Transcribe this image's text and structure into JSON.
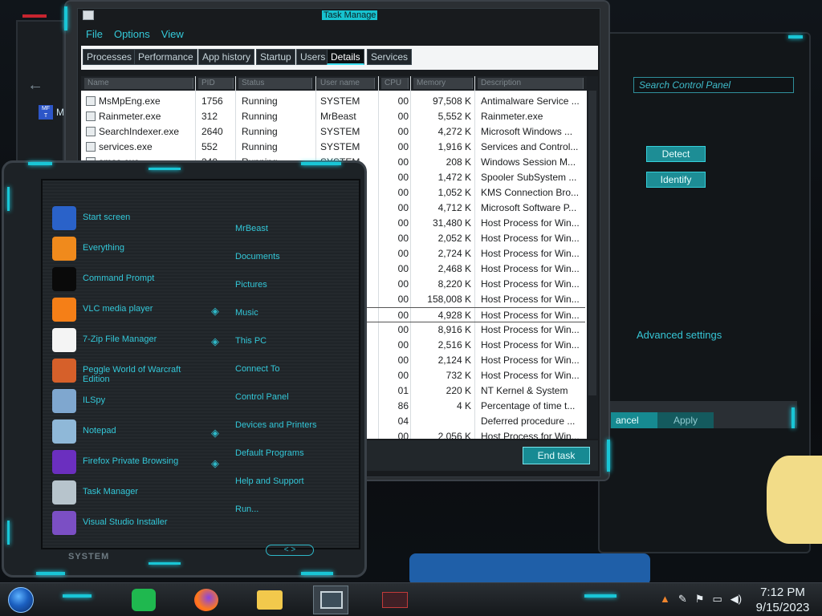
{
  "bg_window": {
    "label": "ME"
  },
  "control_panel": {
    "search_placeholder": "Search Control Panel",
    "detect_label": "Detect",
    "identify_label": "Identify",
    "advanced_label": "Advanced settings",
    "cancel_label": "ancel",
    "apply_label": "Apply"
  },
  "task_manager": {
    "title": "Task Manage",
    "menu": [
      "File",
      "Options",
      "View"
    ],
    "tabs": [
      "Processes",
      "Performance",
      "App history",
      "Startup",
      "Users",
      "Details",
      "Services"
    ],
    "columns": [
      "Name",
      "PID",
      "Status",
      "User name",
      "CPU",
      "Memory",
      "Description"
    ],
    "rows": [
      {
        "name": "MsMpEng.exe",
        "pid": "1756",
        "status": "Running",
        "user": "SYSTEM",
        "cpu": "00",
        "mem": "97,508 K",
        "desc": "Antimalware Service ..."
      },
      {
        "name": "Rainmeter.exe",
        "pid": "312",
        "status": "Running",
        "user": "MrBeast",
        "cpu": "00",
        "mem": "5,552 K",
        "desc": "Rainmeter.exe"
      },
      {
        "name": "SearchIndexer.exe",
        "pid": "2640",
        "status": "Running",
        "user": "SYSTEM",
        "cpu": "00",
        "mem": "4,272 K",
        "desc": "Microsoft Windows ..."
      },
      {
        "name": "services.exe",
        "pid": "552",
        "status": "Running",
        "user": "SYSTEM",
        "cpu": "00",
        "mem": "1,916 K",
        "desc": "Services and Control..."
      },
      {
        "name": "smss.exe",
        "pid": "340",
        "status": "Running",
        "user": "SYSTEM",
        "cpu": "00",
        "mem": "208 K",
        "desc": "Windows Session M..."
      },
      {
        "name": "",
        "pid": "",
        "status": "",
        "user": "",
        "cpu": "00",
        "mem": "1,472 K",
        "desc": "Spooler SubSystem ..."
      },
      {
        "name": "",
        "pid": "",
        "status": "",
        "user": "",
        "cpu": "00",
        "mem": "1,052 K",
        "desc": "KMS Connection Bro..."
      },
      {
        "name": "",
        "pid": "",
        "status": "",
        "user": "",
        "cpu": "00",
        "mem": "4,712 K",
        "desc": "Microsoft Software P..."
      },
      {
        "name": "",
        "pid": "",
        "status": "",
        "user": "",
        "cpu": "00",
        "mem": "31,480 K",
        "desc": "Host Process for Win..."
      },
      {
        "name": "",
        "pid": "",
        "status": "",
        "user": "",
        "cpu": "00",
        "mem": "2,052 K",
        "desc": "Host Process for Win..."
      },
      {
        "name": "",
        "pid": "",
        "status": "",
        "user": "",
        "cpu": "00",
        "mem": "2,724 K",
        "desc": "Host Process for Win..."
      },
      {
        "name": "",
        "pid": "",
        "status": "",
        "user": "",
        "cpu": "00",
        "mem": "2,468 K",
        "desc": "Host Process for Win..."
      },
      {
        "name": "",
        "pid": "",
        "status": "",
        "user": "",
        "cpu": "00",
        "mem": "8,220 K",
        "desc": "Host Process for Win..."
      },
      {
        "name": "",
        "pid": "",
        "status": "",
        "user": "",
        "cpu": "00",
        "mem": "158,008 K",
        "desc": "Host Process for Win..."
      },
      {
        "name": "",
        "pid": "",
        "status": "",
        "user": "",
        "cpu": "00",
        "mem": "4,928 K",
        "desc": "Host Process for Win...",
        "selected": true
      },
      {
        "name": "",
        "pid": "",
        "status": "",
        "user": "",
        "cpu": "00",
        "mem": "8,916 K",
        "desc": "Host Process for Win..."
      },
      {
        "name": "",
        "pid": "",
        "status": "",
        "user": "",
        "cpu": "00",
        "mem": "2,516 K",
        "desc": "Host Process for Win..."
      },
      {
        "name": "",
        "pid": "",
        "status": "",
        "user": "",
        "cpu": "00",
        "mem": "2,124 K",
        "desc": "Host Process for Win..."
      },
      {
        "name": "",
        "pid": "",
        "status": "",
        "user": "",
        "cpu": "00",
        "mem": "732 K",
        "desc": "Host Process for Win..."
      },
      {
        "name": "",
        "pid": "",
        "status": "",
        "user": "",
        "cpu": "01",
        "mem": "220 K",
        "desc": "NT Kernel & System"
      },
      {
        "name": "",
        "pid": "",
        "status": "",
        "user": "",
        "cpu": "86",
        "mem": "4 K",
        "desc": "Percentage of time t..."
      },
      {
        "name": "",
        "pid": "",
        "status": "",
        "user": "",
        "cpu": "04",
        "mem": "",
        "desc": "Deferred procedure ..."
      },
      {
        "name": "",
        "pid": "",
        "status": "",
        "user": "",
        "cpu": "00",
        "mem": "2,056 K",
        "desc": "Host Process for Win..."
      }
    ],
    "end_task_label": "End task"
  },
  "start_menu": {
    "programs": [
      {
        "label": "Start screen",
        "icon": "start-screen-icon",
        "color": "#2a62c9",
        "pinned": false
      },
      {
        "label": "Everything",
        "icon": "search-icon",
        "color": "#f08a1c",
        "pinned": false
      },
      {
        "label": "Command Prompt",
        "icon": "command-prompt-icon",
        "color": "#0a0a0a",
        "pinned": false
      },
      {
        "label": "VLC media player",
        "icon": "vlc-icon",
        "color": "#f57f17",
        "pinned": true
      },
      {
        "label": "7-Zip File Manager",
        "icon": "7zip-icon",
        "color": "#f4f4f4",
        "pinned": true
      },
      {
        "label": "Peggle World of Warcraft Edition",
        "icon": "peggle-icon",
        "color": "#d6602a",
        "pinned": false
      },
      {
        "label": "ILSpy",
        "icon": "ilspy-icon",
        "color": "#7fa7cf",
        "pinned": false
      },
      {
        "label": "Notepad",
        "icon": "notepad-icon",
        "color": "#8fb8d8",
        "pinned": true
      },
      {
        "label": "Firefox Private Browsing",
        "icon": "firefox-private-icon",
        "color": "#6b2fbf",
        "pinned": true
      },
      {
        "label": "Task Manager",
        "icon": "task-manager-icon",
        "color": "#b7c4cc",
        "pinned": false
      },
      {
        "label": "Visual Studio Installer",
        "icon": "visual-studio-icon",
        "color": "#7b4fc4",
        "pinned": false
      }
    ],
    "places": [
      "MrBeast",
      "Documents",
      "Pictures",
      "Music",
      "This PC",
      "Connect To",
      "Control Panel",
      "Devices and Printers",
      "Default Programs",
      "Help and Support",
      "Run..."
    ],
    "system_label": "SYSTEM"
  },
  "taskbar": {
    "time": "7:12 PM",
    "date": "9/15/2023"
  }
}
